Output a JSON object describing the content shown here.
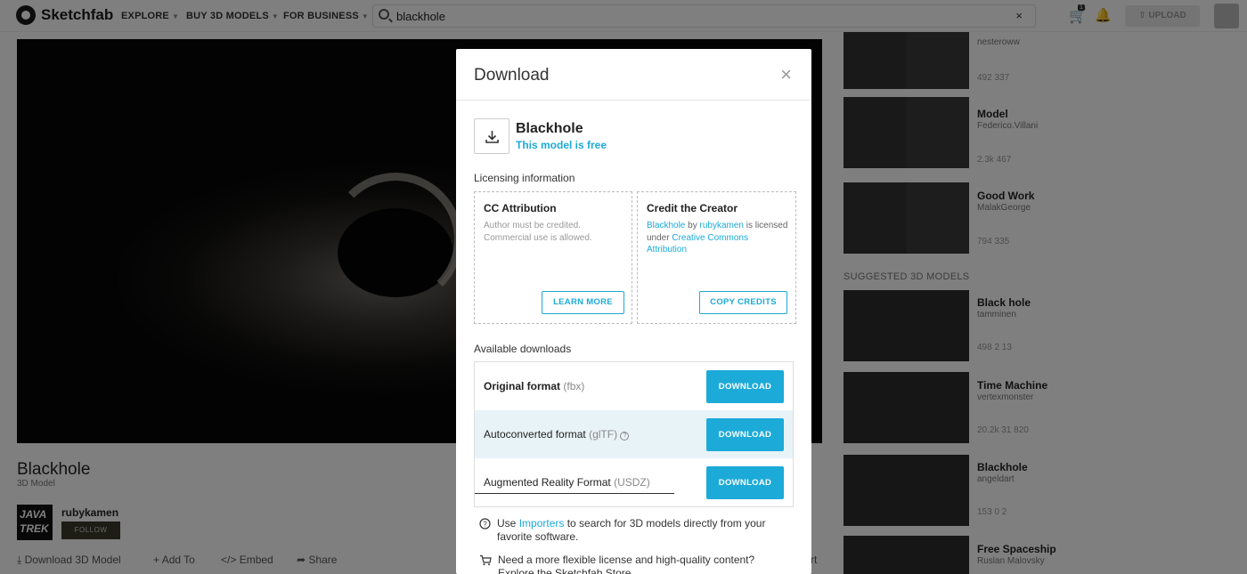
{
  "header": {
    "logo_text": "Sketchfab",
    "nav": [
      {
        "label": "EXPLORE"
      },
      {
        "label": "BUY 3D MODELS"
      },
      {
        "label": "FOR BUSINESS"
      }
    ],
    "search_value": "blackhole",
    "search_clear": "×",
    "cart_count": "1",
    "upload_label": "UPLOAD"
  },
  "model_page": {
    "title": "Blackhole",
    "subtitle": "3D Model",
    "author_avatar_text": "JAVA TREK",
    "author": "rubykamen",
    "follow_label": "FOLLOW",
    "actions": [
      "Download 3D Model",
      "Add To",
      "Embed",
      "Share"
    ],
    "report_fragment": "rt"
  },
  "sidebar": {
    "top_cards": [
      {
        "title": "",
        "author": "nesteroww",
        "stats": "492   337"
      },
      {
        "title": "Model",
        "author": "Federico.Villani",
        "stats": "2.3k   467"
      },
      {
        "title": "Good Work",
        "author": "MalakGeorge",
        "stats": "794   335"
      }
    ],
    "suggested_label": "SUGGESTED 3D MODELS",
    "suggested": [
      {
        "title": "Black hole",
        "author": "tamminen",
        "stats": "498    2    13"
      },
      {
        "title": "Time Machine",
        "author": "vertexmonster",
        "stats": "20.2k    31    820"
      },
      {
        "title": "Blackhole",
        "author": "angeldart",
        "stats": "153    0    2"
      },
      {
        "title": "Free Spaceship",
        "author": "Ruslan Malovsky",
        "stats": ""
      }
    ]
  },
  "modal": {
    "title": "Download",
    "close": "×",
    "model_name": "Blackhole",
    "model_free": "This model is free",
    "licensing_label": "Licensing information",
    "license_card": {
      "title": "CC Attribution",
      "desc": "Author must be credited. Commercial use is allowed.",
      "button": "LEARN MORE"
    },
    "credit_card": {
      "title": "Credit the Creator",
      "model_link": "Blackhole",
      "by": " by ",
      "author_link": "rubykamen",
      "mid": " is licensed under ",
      "license_link": "Creative Commons Attribution",
      "button": "COPY CREDITS"
    },
    "available_label": "Available downloads",
    "downloads": [
      {
        "name": "Original format",
        "ext": "(fbx)",
        "button": "DOWNLOAD"
      },
      {
        "name": "Autoconverted format",
        "ext": "(glTF)",
        "button": "DOWNLOAD"
      },
      {
        "name": "Augmented Reality Format",
        "ext": "(USDZ)",
        "button": "DOWNLOAD"
      }
    ],
    "tip1": {
      "pre": "Use ",
      "link": "Importers",
      "post": " to search for 3D models directly from your favorite software."
    },
    "tip2": {
      "line1": "Need a more flexible license and high-quality content?",
      "line2": "Explore the Sketchfab Store"
    },
    "accent_color": "#1caad9"
  }
}
